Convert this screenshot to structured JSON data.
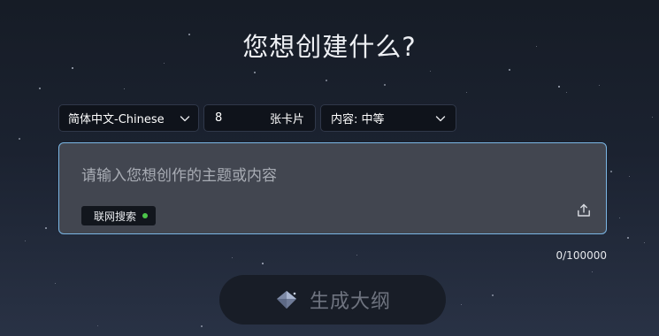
{
  "page": {
    "title": "您想创建什么?"
  },
  "controls": {
    "language": {
      "value": "简体中文-Chinese"
    },
    "card_count": {
      "value": "8",
      "unit": "张卡片"
    },
    "content_level": {
      "value": "内容: 中等"
    }
  },
  "prompt": {
    "placeholder": "请输入您想创作的主题或内容",
    "value": "",
    "web_search_label": "联网搜索",
    "web_search_status_color": "#4cc54a",
    "upload_icon": "upload-icon"
  },
  "char_count": "0/100000",
  "generate": {
    "label": "生成大纲",
    "icon": "gem-icon"
  },
  "colors": {
    "accent_border": "#7bb6e4",
    "background_top": "#161c26",
    "background_bottom": "#293245"
  }
}
